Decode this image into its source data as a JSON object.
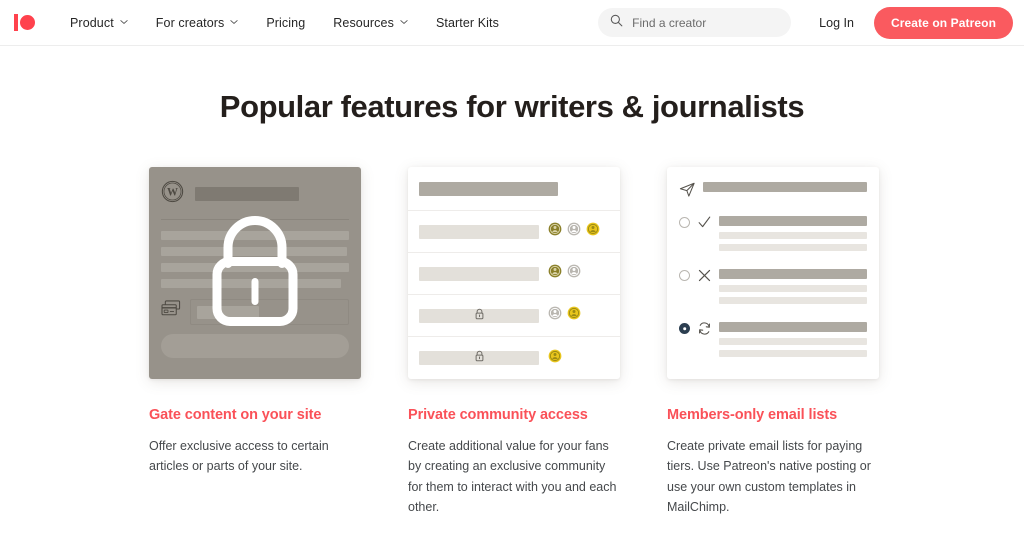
{
  "header": {
    "logo": "patreon-logo",
    "nav": [
      {
        "label": "Product",
        "caret": true
      },
      {
        "label": "For creators",
        "caret": true
      },
      {
        "label": "Pricing",
        "caret": false
      },
      {
        "label": "Resources",
        "caret": true
      },
      {
        "label": "Starter Kits",
        "caret": false
      }
    ],
    "search": {
      "icon": "search-icon",
      "placeholder": "Find a creator",
      "value": ""
    },
    "login_label": "Log In",
    "cta_label": "Create on Patreon"
  },
  "main": {
    "title": "Popular features for writers & journalists",
    "cards": [
      {
        "illustration": "gated-wordpress-article",
        "title": "Gate content on your site",
        "body": "Offer exclusive access to certain articles or parts of your site."
      },
      {
        "illustration": "private-community-member-list",
        "title": "Private community access",
        "body": "Create additional value for your fans by creating an exclusive community for them to interact with you and each other."
      },
      {
        "illustration": "members-only-email-list",
        "title": "Members-only email lists",
        "body": "Create private email lists for paying tiers. Use Patreon's native posting or use your own custom templates in MailChimp."
      }
    ]
  },
  "colors": {
    "brand_red": "#ff424d",
    "cta_red": "#fa5a5f",
    "title_red": "#fa5158",
    "heading_dark": "#241f1c",
    "body_gray": "#45484b",
    "illus_taupe": "#97928a",
    "badge_olive": "#8a7f28",
    "badge_gray": "#b9b6b0",
    "badge_gold": "#e8c51c",
    "radio_filled": "#2c3e50"
  }
}
